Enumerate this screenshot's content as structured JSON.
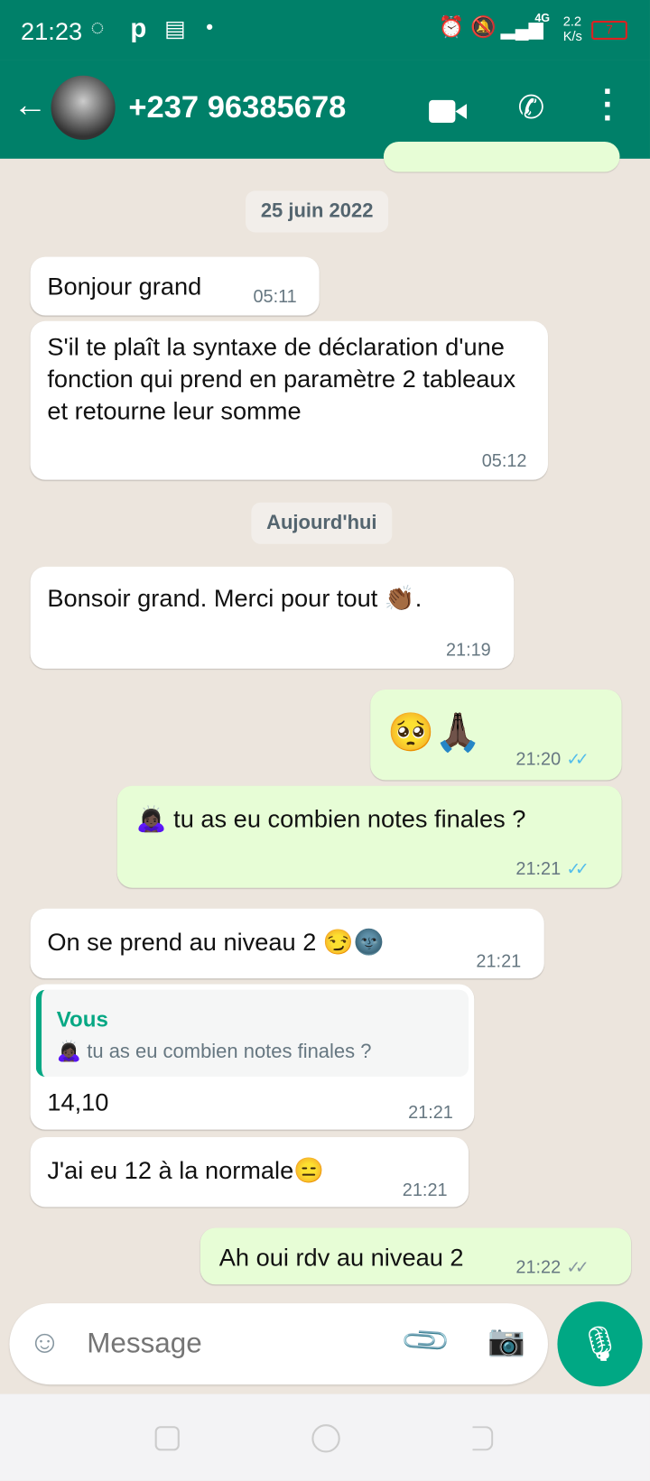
{
  "status_bar": {
    "time": "21:23",
    "network": "4G",
    "speed": "2.2",
    "speed_unit": "K/s",
    "battery": "7"
  },
  "header": {
    "contact": "+237 96385678"
  },
  "colors": {
    "header": "#008069",
    "incoming": "#ffffff",
    "outgoing": "#e7fdd6",
    "read_ticks": "#53bdeb",
    "reply_accent": "#06a884"
  },
  "messages": [
    {
      "type": "date",
      "text": "25 juin 2022"
    },
    {
      "dir": "in",
      "text": "Bonjour grand",
      "time": "05:11"
    },
    {
      "dir": "in",
      "text": "S'il te plaît la syntaxe de déclaration d'une fonction qui prend en paramètre 2 tableaux et retourne leur somme",
      "time": "05:12"
    },
    {
      "type": "date",
      "text": "Aujourd'hui"
    },
    {
      "dir": "in",
      "text": "Bonsoir grand. Merci pour tout 👏🏾.",
      "time": "21:19"
    },
    {
      "dir": "out",
      "text": "🥺🙏🏿",
      "time": "21:20",
      "status": "✓✓"
    },
    {
      "dir": "out",
      "text": "🙇🏿‍♀️ tu as eu combien notes finales ?",
      "time": "21:21",
      "status": "✓✓"
    },
    {
      "dir": "in",
      "text": "On se prend au niveau 2 😏🌚",
      "time": "21:21"
    },
    {
      "dir": "in",
      "reply_author": "Vous",
      "reply_text": "🙇🏿‍♀️ tu as eu combien notes finales ?",
      "text": "14,10",
      "time": "21:21"
    },
    {
      "dir": "in",
      "text": "J'ai eu 12 à la normale😑",
      "time": "21:21"
    },
    {
      "dir": "out",
      "text": "Ah oui rdv au niveau 2",
      "time": "21:22",
      "status": "✓✓"
    }
  ],
  "composer": {
    "placeholder": "Message"
  }
}
